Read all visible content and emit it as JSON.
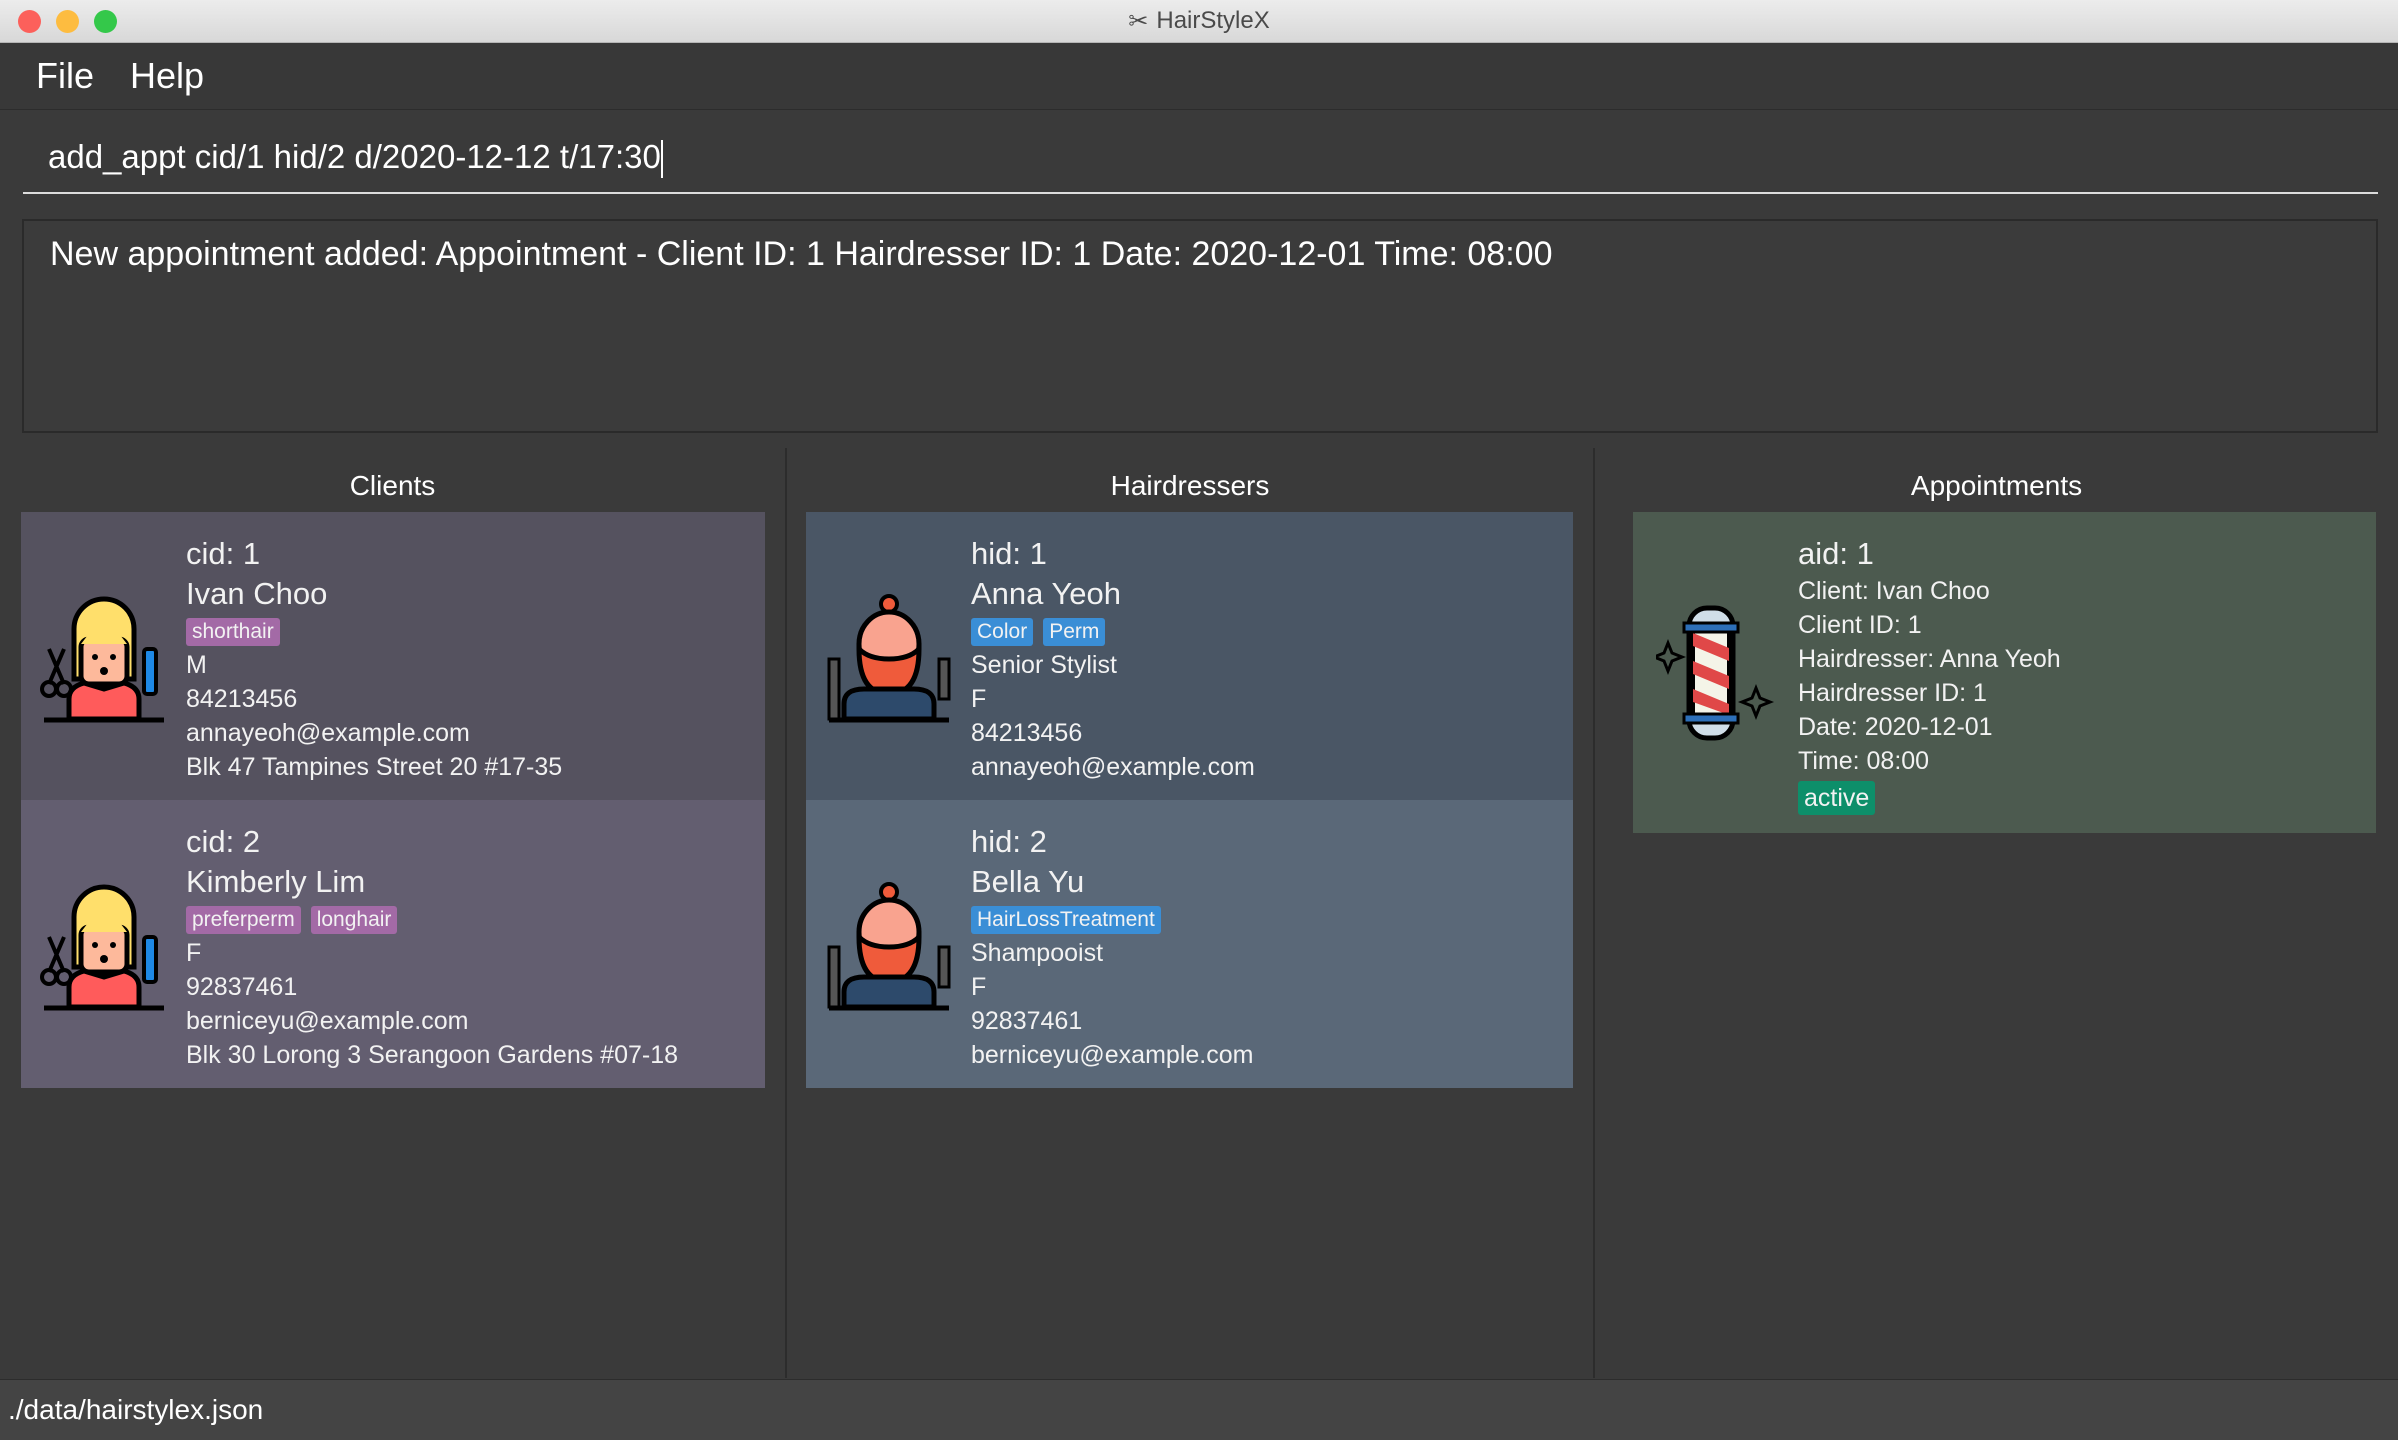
{
  "window": {
    "title": "HairStyleX"
  },
  "menu": [
    "File",
    "Help"
  ],
  "command": {
    "value": "add_appt cid/1 hid/2 d/2020-12-12 t/17:30"
  },
  "result": {
    "text": "New appointment added: Appointment - Client ID: 1 Hairdresser ID: 1 Date: 2020-12-01 Time: 08:00"
  },
  "clients": {
    "title": "Clients",
    "items": [
      {
        "id": "cid: 1",
        "name": "Ivan Choo",
        "tags": [
          "shorthair"
        ],
        "gender": "M",
        "phone": "84213456",
        "email": "annayeoh@example.com",
        "address": "Blk 47 Tampines Street 20 #17-35"
      },
      {
        "id": "cid: 2",
        "name": "Kimberly Lim",
        "tags": [
          "preferperm",
          "longhair"
        ],
        "gender": "F",
        "phone": "92837461",
        "email": "berniceyu@example.com",
        "address": "Blk 30 Lorong 3 Serangoon Gardens #07-18"
      }
    ]
  },
  "hairdressers": {
    "title": "Hairdressers",
    "items": [
      {
        "id": "hid: 1",
        "name": "Anna Yeoh",
        "tags": [
          "Color",
          "Perm"
        ],
        "title": "Senior Stylist",
        "gender": "F",
        "phone": "84213456",
        "email": "annayeoh@example.com"
      },
      {
        "id": "hid: 2",
        "name": "Bella Yu",
        "tags": [
          "HairLossTreatment"
        ],
        "title": "Shampooist",
        "gender": "F",
        "phone": "92837461",
        "email": "berniceyu@example.com"
      }
    ]
  },
  "appointments": {
    "title": "Appointments",
    "items": [
      {
        "id": "aid: 1",
        "client": "Client:  Ivan Choo",
        "client_id": "Client ID: 1",
        "hairdresser": "Hairdresser:  Anna Yeoh",
        "hairdresser_id": "Hairdresser ID: 1",
        "date": "Date: 2020-12-01",
        "time": "Time: 08:00",
        "status": "active"
      }
    ]
  },
  "statusbar": {
    "path": "./data/hairstylex.json"
  },
  "colors": {
    "client_tag": "#a36aa6",
    "hairdresser_tag": "#3a8ed6",
    "status_tag": "#0d8f6a"
  }
}
